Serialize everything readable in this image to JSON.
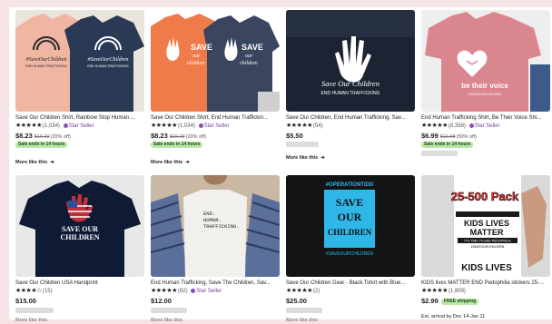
{
  "corner_letter": "P",
  "more_like_this": "More like this",
  "products": [
    {
      "title": "Save Our Children Shirt, Rainbow Stop Human ...",
      "stars": "★★★★★",
      "count": "(1,034)",
      "star_seller": "Star Seller",
      "price": "$8.23",
      "orig": "$10.29",
      "pct": "(20% off)",
      "sale": "Sale ends in 14 hours",
      "img_text": [
        "#SaveOurChildren",
        "END HUMAN TRAFFICKING"
      ]
    },
    {
      "title": "Save Our Children Shirt, End Human Traffickin...",
      "stars": "★★★★★",
      "count": "(1,034)",
      "star_seller": "Star Seller",
      "price": "$8.23",
      "orig": "$10.29",
      "pct": "(20% off)",
      "sale": "Sale ends in 14 hours",
      "img_text": [
        "SAVE",
        "our",
        "children"
      ]
    },
    {
      "title": "Save Our Children, End Human Trafficking, Sav...",
      "stars": "★★★★★",
      "count": "(54)",
      "star_seller": "",
      "price": "$5.50",
      "orig": "",
      "pct": "",
      "sale": "",
      "img_text": [
        "Save Our Children",
        "END HUMAN TRAFFICKING"
      ]
    },
    {
      "title": "End Human Trafficking Shirt, Be Their Voice Shi...",
      "stars": "★★★★★",
      "count": "(8,358)",
      "star_seller": "Star Seller",
      "price": "$6.99",
      "orig": "$13.98",
      "pct": "(50% off)",
      "sale": "Sale ends in 14 hours",
      "img_text": [
        "be their voice",
        "#SAVEOURCHILDREN"
      ]
    },
    {
      "title": "Save Our Children USA Handprint",
      "stars": "★★★★☆",
      "count": "(15)",
      "star_seller": "",
      "price": "$15.00",
      "orig": "",
      "pct": "",
      "sale": "",
      "img_text": [
        "SAVE OUR",
        "CHILDREN"
      ]
    },
    {
      "title": "End Human Trafficking, Save The Children, Sav...",
      "stars": "★★★★★",
      "count": "(92)",
      "star_seller": "Star Seller",
      "price": "$12.00",
      "orig": "",
      "pct": "",
      "sale": "",
      "img_text": [
        "END.",
        "HUMAN.",
        "TRAFFICKING."
      ]
    },
    {
      "title": "Save Our Children Gear - Black Tshirt with Blue...",
      "stars": "★★★★★",
      "count": "(2)",
      "star_seller": "",
      "price": "$25.00",
      "orig": "",
      "pct": "",
      "sale": "",
      "img_text": [
        "#OPERATIONTIDD",
        "SAVE",
        "OUR",
        "CHILDREN",
        "#SAVEOURCHILDREN"
      ]
    },
    {
      "title": "KIDS lives MATTER END Pedophilia stickers 25-...",
      "stars": "★★★★★",
      "count": "(1,809)",
      "star_seller": "",
      "price": "$2.99",
      "orig": "",
      "pct": "",
      "sale": "",
      "free_shipping": "FREE shipping",
      "est": "Est. arrival by Dec 14-Jan 11",
      "img_text": [
        "25-500 Pack",
        "KIDS LIVES",
        "MATTER",
        "IT'S TIME TO END PEDOPHILIA",
        "#SAVEOURCHILDREN",
        "KIDS LIVES"
      ]
    }
  ],
  "colors": {
    "background": "#f6e3e5",
    "sale_badge": "#b8e6a8",
    "star_seller": "#7b3fa3"
  }
}
